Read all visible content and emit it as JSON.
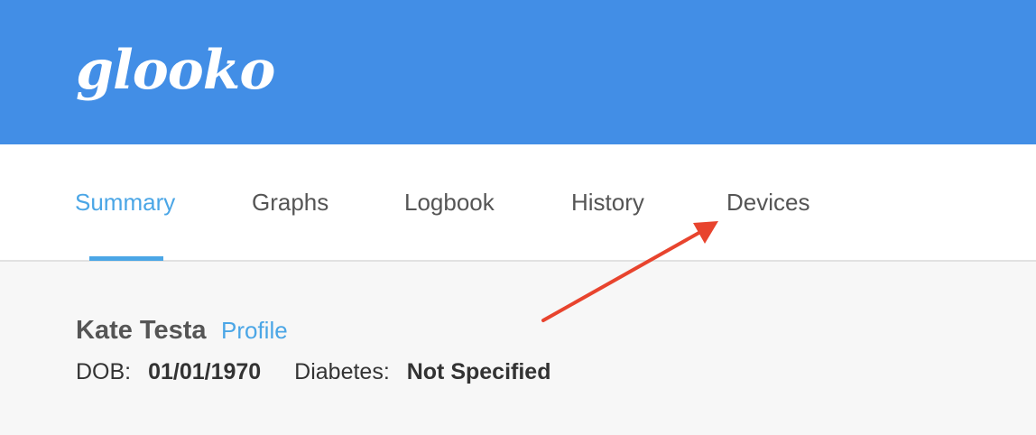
{
  "header": {
    "logo_text": "glooko",
    "background_color": "#428ee6"
  },
  "nav": {
    "tabs": [
      {
        "label": "Summary",
        "active": true
      },
      {
        "label": "Graphs",
        "active": false
      },
      {
        "label": "Logbook",
        "active": false
      },
      {
        "label": "History",
        "active": false
      },
      {
        "label": "Devices",
        "active": false
      }
    ],
    "active_color": "#4ba6e6"
  },
  "patient": {
    "name": "Kate Testa",
    "profile_link": "Profile",
    "dob_label": "DOB:",
    "dob_value": "01/01/1970",
    "diabetes_label": "Diabetes:",
    "diabetes_value": "Not Specified"
  },
  "annotation": {
    "arrow_color": "#e8442e",
    "points_to": "Devices"
  }
}
